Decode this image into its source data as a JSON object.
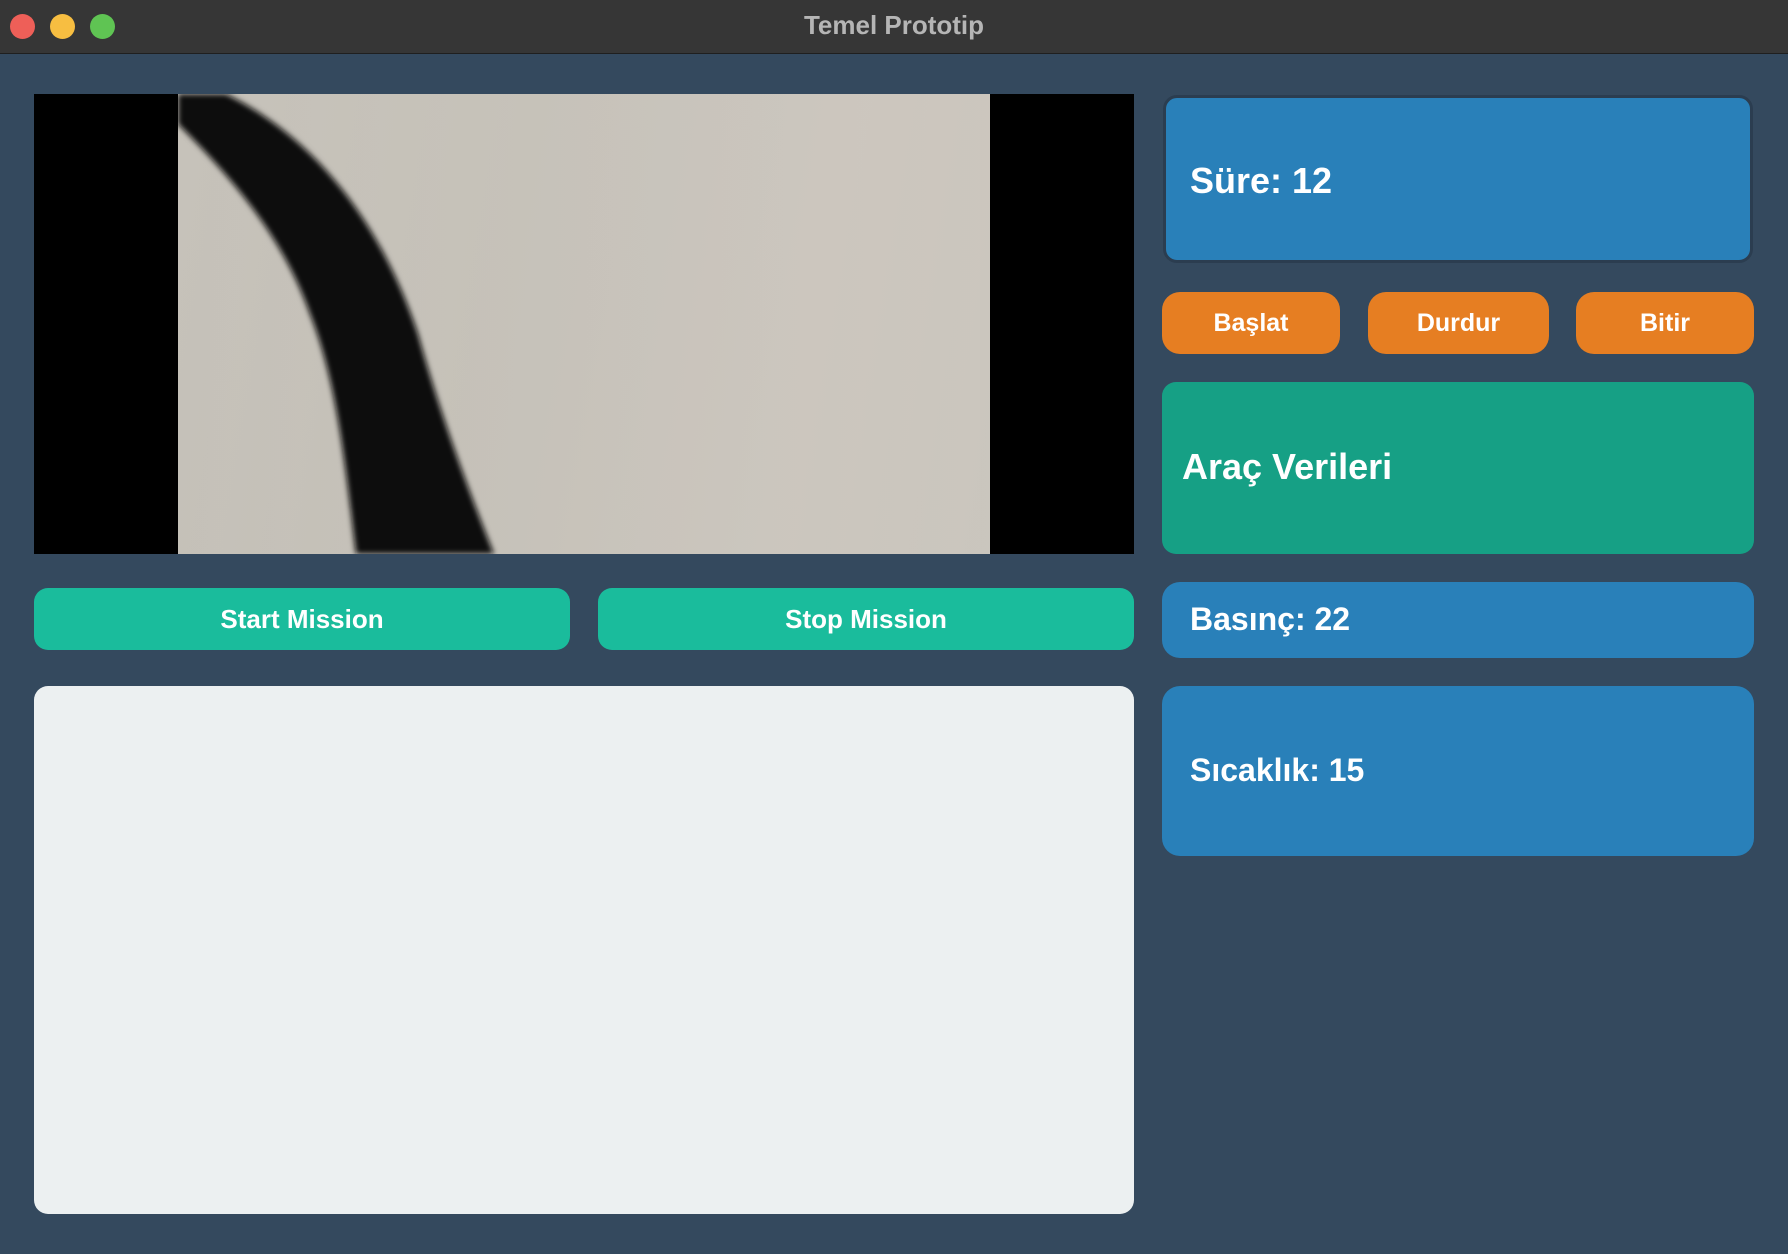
{
  "window": {
    "title": "Temel Prototip"
  },
  "mission": {
    "start_label": "Start Mission",
    "stop_label": "Stop Mission"
  },
  "timer": {
    "label": "Süre: 12"
  },
  "controls": {
    "start_label": "Başlat",
    "pause_label": "Durdur",
    "finish_label": "Bitir"
  },
  "vehicle": {
    "header": "Araç Verileri",
    "pressure": "Basınç: 22",
    "temperature": "Sıcaklık: 15"
  },
  "colors": {
    "background": "#34495e",
    "teal_button": "#1abc9c",
    "orange_button": "#e67e22",
    "blue_panel": "#2980b9",
    "green_panel": "#16a085",
    "log_panel": "#ecf0f1"
  }
}
